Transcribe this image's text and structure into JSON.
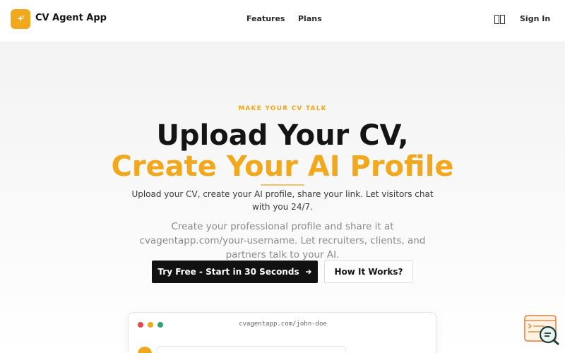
{
  "header": {
    "brand": "CV Agent App",
    "nav": [
      "Features",
      "Plans"
    ],
    "lang_icon": "language-icon",
    "signin": "Sign In"
  },
  "hero": {
    "eyebrow": "MAKE YOUR CV TALK",
    "title_line1": "Upload Your CV,",
    "title_line2": "Create Your AI Profile",
    "subtitle1": "Upload your CV, create your AI profile, share your link. Let visitors chat with you 24/7.",
    "subtitle2": "Create your professional profile and share it at cvagentapp.com/your-username. Let recruiters, clients, and partners talk to your AI.",
    "cta_primary": "Try Free - Start in 30 Seconds",
    "cta_primary_icon": "arrow-right-icon",
    "cta_secondary": "How It Works?"
  },
  "preview": {
    "url": "cvagentapp.com/john-doe",
    "window_dots": [
      "#e5484d",
      "#f2a81d",
      "#30a46c"
    ]
  },
  "widget": {
    "icon": "chat-search-icon"
  },
  "colors": {
    "accent": "#f2a81d",
    "dark": "#111111"
  }
}
